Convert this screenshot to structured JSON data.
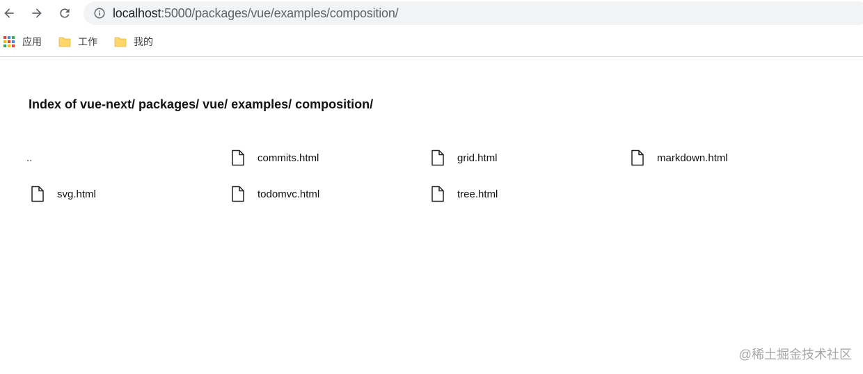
{
  "browser": {
    "url_host": "localhost",
    "url_path": ":5000/packages/vue/examples/composition/",
    "bookmarks": [
      {
        "label": "应用",
        "icon": "apps-grid-icon"
      },
      {
        "label": "工作",
        "icon": "folder-icon"
      },
      {
        "label": "我的",
        "icon": "folder-icon"
      }
    ]
  },
  "page": {
    "title": "Index of  vue-next/ packages/ vue/ examples/ composition/",
    "entries": [
      {
        "name": "..",
        "icon": "none"
      },
      {
        "name": "commits.html",
        "icon": "file-icon"
      },
      {
        "name": "grid.html",
        "icon": "file-icon"
      },
      {
        "name": "markdown.html",
        "icon": "file-icon"
      },
      {
        "name": "svg.html",
        "icon": "file-icon"
      },
      {
        "name": "todomvc.html",
        "icon": "file-icon"
      },
      {
        "name": "tree.html",
        "icon": "file-icon"
      }
    ]
  },
  "watermark": "@稀土掘金技术社区",
  "colors": {
    "omnibox_bg": "#f1f3f4",
    "folder_yellow": "#fbd66a",
    "watermark": "#a6a6a6"
  }
}
